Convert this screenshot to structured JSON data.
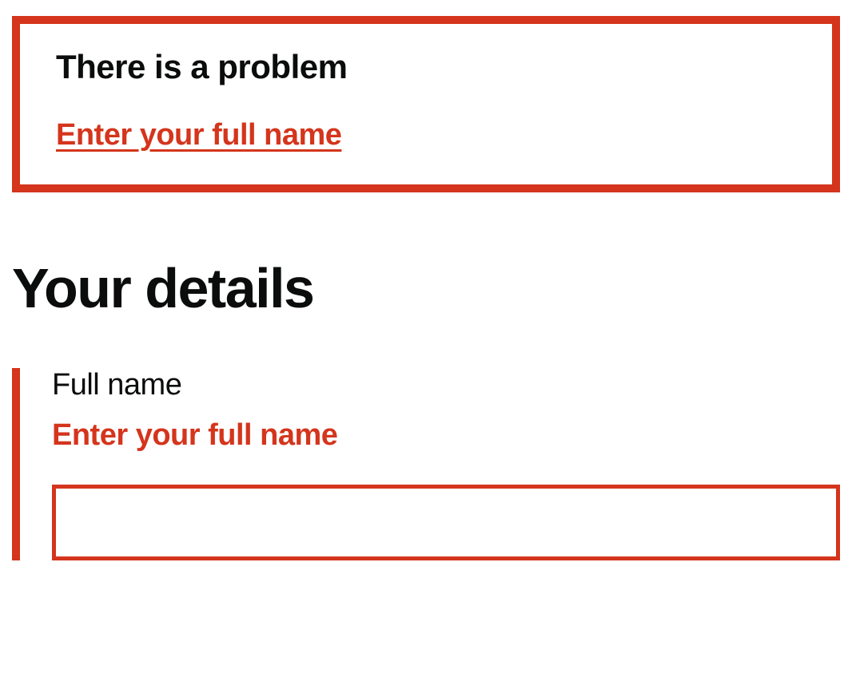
{
  "errorSummary": {
    "title": "There is a problem",
    "links": [
      {
        "text": "Enter your full name"
      }
    ]
  },
  "page": {
    "heading": "Your details"
  },
  "form": {
    "fullName": {
      "label": "Full name",
      "errorMessage": "Enter your full name",
      "value": ""
    }
  },
  "colors": {
    "error": "#d4351c",
    "text": "#0b0c0c"
  }
}
